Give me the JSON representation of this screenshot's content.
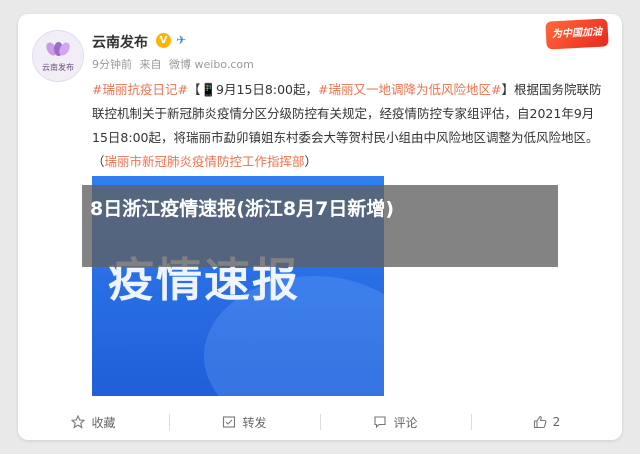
{
  "post": {
    "account_name": "云南发布",
    "avatar_label": "云南发布",
    "verified_mark": "V",
    "meta": {
      "time": "9分钟前",
      "source_prefix": "来自",
      "source": "微博 weibo.com"
    },
    "badge": "为中国加油",
    "text": {
      "tag1": "#瑞丽抗疫日记#",
      "bracket_open": "【",
      "date_note": "9月15日8:00起，",
      "tag2": "#瑞丽又一地调降为低风险地区#",
      "bracket_close": "】",
      "body": "根据国务院联防联控机制关于新冠肺炎疫情分区分级防控有关规定，经疫情防控专家组评估，自2021年9月15日8:00起，将瑞丽市勐卯镇姐东村委会大等贺村民小组由中风险地区调整为低风险地区。（",
      "link": "瑞丽市新冠肺炎疫情防控工作指挥部",
      "tail": "）"
    },
    "image_title": "疫情速报"
  },
  "actions": {
    "favorite": "收藏",
    "repost": "转发",
    "comment": "评论",
    "like_count": "2"
  },
  "overlay": {
    "title": "8日浙江疫情速报(浙江8月7日新增)"
  },
  "colors": {
    "accent": "#eb7350",
    "image_blue": "#2a6fe6",
    "verified": "#ffb400"
  }
}
